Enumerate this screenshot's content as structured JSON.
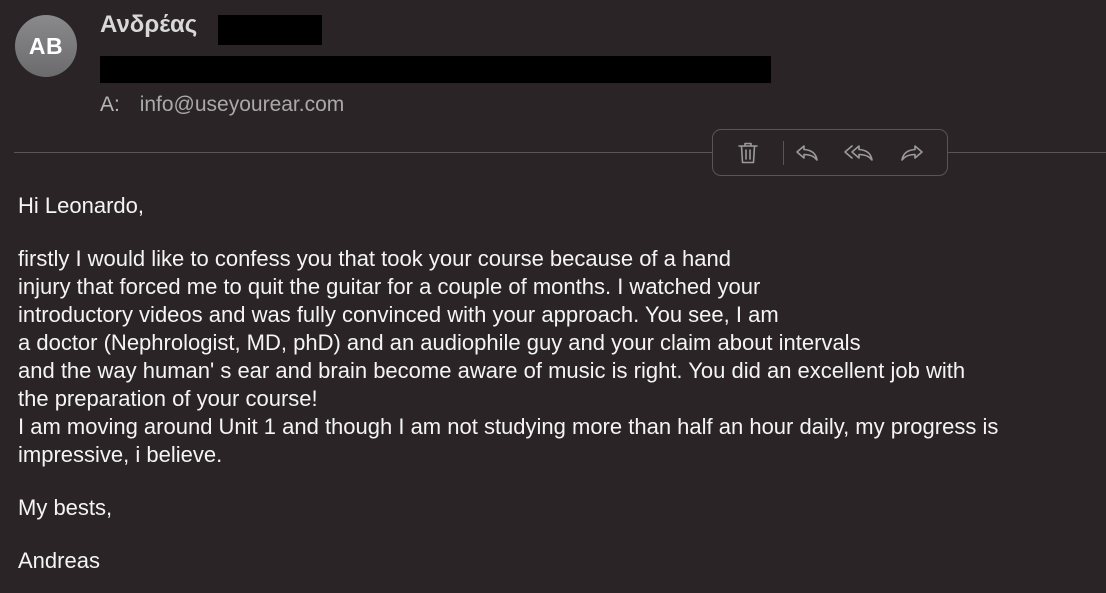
{
  "header": {
    "avatar_initials": "AB",
    "sender_name": "Ανδρέας",
    "to_label": "A:",
    "to_address": "info@useyourear.com"
  },
  "toolbar": {
    "buttons": [
      {
        "icon": "trash-icon"
      },
      {
        "icon": "reply-icon"
      },
      {
        "icon": "reply-all-icon"
      },
      {
        "icon": "forward-icon"
      }
    ]
  },
  "message": {
    "greeting": "Hi Leonardo,",
    "paragraph_lines": [
      "firstly I would like to confess you that took your course because of a hand",
      "injury that forced me to quit the guitar for a couple of months. I watched your",
      "introductory videos and was fully convinced with your approach. You see, I am",
      "a doctor (Nephrologist, MD, phD) and an audiophile guy and your claim about intervals",
      "and the way human' s ear and brain become aware of music is right. You did an excellent job with",
      "the preparation of your course!",
      "I am moving around Unit 1 and though I am not studying more than half an hour daily, my progress is",
      "impressive, i believe."
    ],
    "closing": "My bests,",
    "signature": "Andreas"
  }
}
